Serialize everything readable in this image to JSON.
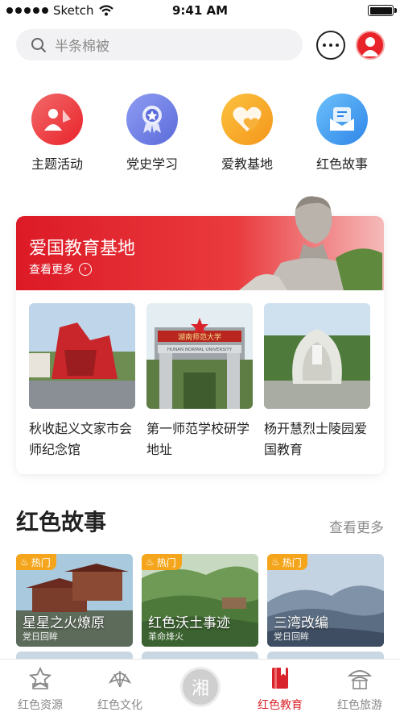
{
  "status_bar": {
    "carrier": "Sketch",
    "time": "9:41 AM"
  },
  "search": {
    "placeholder": "半条棉被"
  },
  "quick_nav": [
    {
      "label": "主题活动",
      "icon": "people-flag-icon",
      "color": "#f0484a"
    },
    {
      "label": "党史学习",
      "icon": "medal-icon",
      "color": "#6d7de8"
    },
    {
      "label": "爱教基地",
      "icon": "heart-icon",
      "color": "#f7a91e"
    },
    {
      "label": "红色故事",
      "icon": "message-book-icon",
      "color": "#4aa0f1"
    }
  ],
  "education_base": {
    "title": "爱国教育基地",
    "more": "查看更多",
    "items": [
      {
        "name": "秋收起义文家市会师纪念馆"
      },
      {
        "name": "第一师范学校研学地址",
        "sign_text": "湖南师范大学",
        "sign_sub": "HUNAN NORMAL UNIVERSITY"
      },
      {
        "name": "杨开慧烈士陵园爱国教育"
      }
    ]
  },
  "stories_section": {
    "title": "红色故事",
    "more": "查看更多",
    "items": [
      {
        "badge": "热门",
        "title": "星星之火燎原",
        "subtitle": "党日回眸"
      },
      {
        "badge": "热门",
        "title": "红色沃土事迹",
        "subtitle": "革命烽火"
      },
      {
        "badge": "热门",
        "title": "三湾改编",
        "subtitle": "党日回眸"
      }
    ]
  },
  "tabbar": {
    "center": "湘",
    "tabs": [
      {
        "label": "红色资源",
        "icon": "star-badge-icon"
      },
      {
        "label": "红色文化",
        "icon": "fan-icon"
      },
      {
        "label": "红色教育",
        "icon": "red-book-icon",
        "active": true
      },
      {
        "label": "红色旅游",
        "icon": "pavilion-icon"
      }
    ]
  },
  "colors": {
    "brand_red": "#d8232a",
    "hot_badge": "#f4a51b",
    "muted_text": "#8a8a8a"
  }
}
